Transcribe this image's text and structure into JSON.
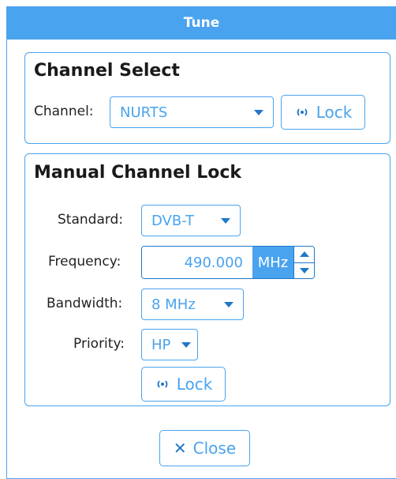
{
  "dialog": {
    "title": "Tune"
  },
  "channel_select": {
    "title": "Channel Select",
    "channel_label": "Channel:",
    "channel_value": "NURTS",
    "lock_label": "Lock",
    "lock_icon": "radio-wave-icon"
  },
  "manual_lock": {
    "title": "Manual Channel Lock",
    "standard_label": "Standard:",
    "standard_value": "DVB-T",
    "frequency_label": "Frequency:",
    "frequency_value": "490.000",
    "frequency_unit": "MHz",
    "bandwidth_label": "Bandwidth:",
    "bandwidth_value": "8 MHz",
    "priority_label": "Priority:",
    "priority_value": "HP",
    "lock_label": "Lock",
    "lock_icon": "radio-wave-icon"
  },
  "footer": {
    "close_label": "Close",
    "close_icon": "close-icon"
  },
  "colors": {
    "accent": "#4aa3ee",
    "accent_dark": "#1f77c8",
    "text": "#222222"
  }
}
